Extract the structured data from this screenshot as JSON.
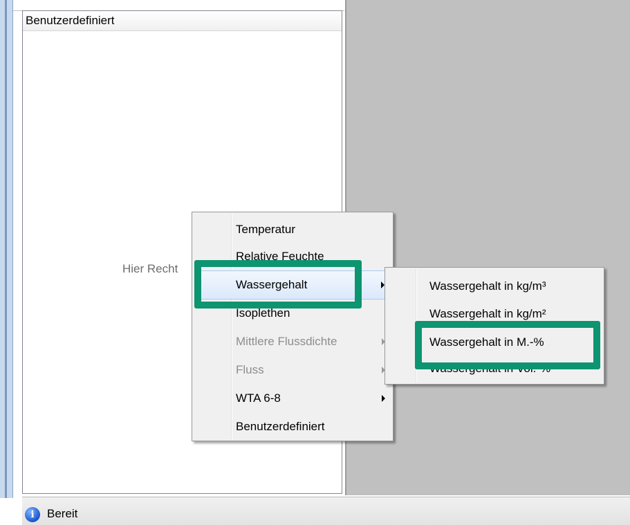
{
  "panel": {
    "header": "Benutzerdefiniert",
    "hint": "Hier Recht"
  },
  "status": {
    "icon": "info-icon",
    "text": "Bereit"
  },
  "context_menu": {
    "items": [
      {
        "label": "Temperatur",
        "enabled": true,
        "submenu": false
      },
      {
        "label": "Relative Feuchte",
        "enabled": true,
        "submenu": false
      },
      {
        "label": "Wassergehalt",
        "enabled": true,
        "submenu": true,
        "selected": true
      },
      {
        "label": "Isoplethen",
        "enabled": true,
        "submenu": false
      },
      {
        "label": "Mittlere Flussdichte",
        "enabled": false,
        "submenu": true
      },
      {
        "label": "Fluss",
        "enabled": false,
        "submenu": true
      },
      {
        "label": "WTA 6-8",
        "enabled": true,
        "submenu": true
      },
      {
        "label": "Benutzerdefiniert",
        "enabled": true,
        "submenu": false
      }
    ]
  },
  "submenu": {
    "items": [
      {
        "label": "Wassergehalt in kg/m³"
      },
      {
        "label": "Wassergehalt in kg/m²"
      },
      {
        "label": "Wassergehalt in M.-%"
      },
      {
        "label": "Wassergehalt in Vol.-%"
      }
    ]
  },
  "colors": {
    "highlight": "#0d9470",
    "gray_area": "#c0c0c0"
  }
}
